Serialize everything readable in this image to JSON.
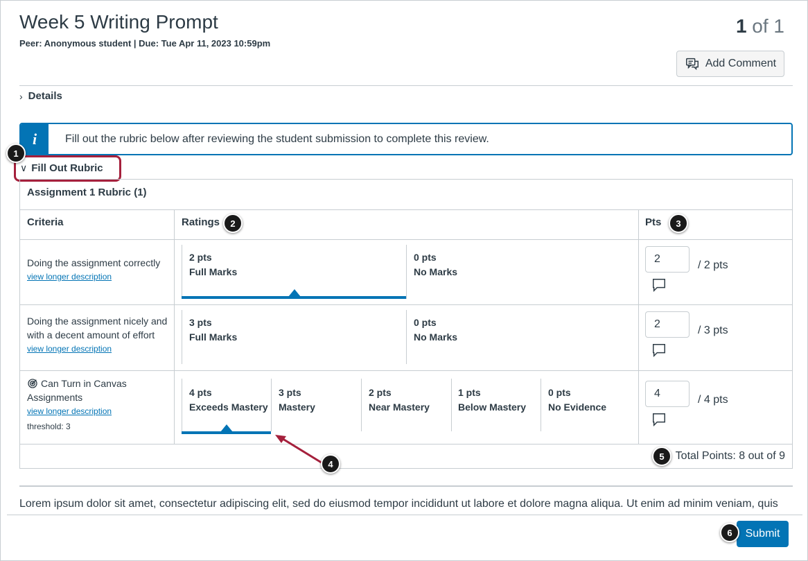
{
  "header": {
    "title": "Week 5 Writing Prompt",
    "subtitle": "Peer: Anonymous student | Due: Tue Apr 11, 2023 10:59pm",
    "pager_current": "1",
    "pager_rest": "of 1",
    "add_comment_label": "Add Comment"
  },
  "details": {
    "label": "Details"
  },
  "alert": {
    "icon": "i",
    "text": "Fill out the rubric below after reviewing the student submission to complete this review."
  },
  "fill_rubric": {
    "label": "Fill Out Rubric"
  },
  "rubric": {
    "title": "Assignment 1 Rubric (1)",
    "headers": {
      "criteria": "Criteria",
      "ratings": "Ratings",
      "pts": "Pts"
    },
    "rows": [
      {
        "criterion": "Doing the assignment correctly",
        "link": "view longer description",
        "ratings": [
          {
            "pts": "2 pts",
            "label": "Full Marks"
          },
          {
            "pts": "0 pts",
            "label": "No Marks"
          }
        ],
        "selected_index": 0,
        "points_value": "2",
        "points_of": "/ 2 pts"
      },
      {
        "criterion": "Doing the assignment nicely and with a decent amount of effort",
        "link": "view longer description",
        "ratings": [
          {
            "pts": "3 pts",
            "label": "Full Marks"
          },
          {
            "pts": "0 pts",
            "label": "No Marks"
          }
        ],
        "selected_index": null,
        "points_value": "2",
        "points_of": "/ 3 pts"
      },
      {
        "criterion": "Can Turn in Canvas Assignments",
        "link": "view longer description",
        "threshold": "threshold: 3",
        "ratings": [
          {
            "pts": "4 pts",
            "label": "Exceeds Mastery"
          },
          {
            "pts": "3 pts",
            "label": "Mastery"
          },
          {
            "pts": "2 pts",
            "label": "Near Mastery"
          },
          {
            "pts": "1 pts",
            "label": "Below Mastery"
          },
          {
            "pts": "0 pts",
            "label": "No Evidence"
          }
        ],
        "selected_index": 0,
        "points_value": "4",
        "points_of": "/ 4 pts"
      }
    ],
    "total": "Total Points: 8 out of 9"
  },
  "submission_text": "Lorem ipsum dolor sit amet, consectetur adipiscing elit, sed do eiusmod tempor incididunt ut labore et dolore magna aliqua. Ut enim ad minim veniam, quis",
  "submit_label": "Submit",
  "callouts": [
    "1",
    "2",
    "3",
    "4",
    "5",
    "6"
  ],
  "colors": {
    "accent": "#0374b5",
    "highlight_border": "#a5203c",
    "text": "#2d3b45",
    "border": "#c7cdd1"
  }
}
